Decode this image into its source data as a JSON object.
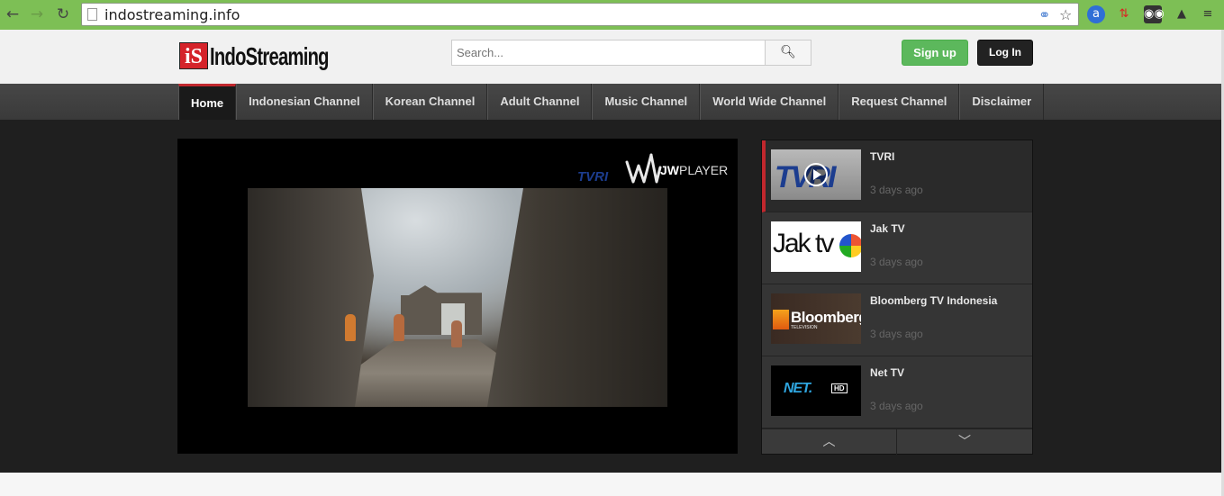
{
  "browser": {
    "url": "indostreaming.info",
    "back_icon": "back-arrow-icon",
    "forward_icon": "forward-arrow-icon",
    "reload_icon": "reload-icon",
    "translate_icon": "translate-icon",
    "bookmark_icon": "star-icon",
    "extensions": [
      "extension-a-icon",
      "extension-arrows-icon",
      "extension-glasses-icon",
      "extension-tower-icon",
      "menu-icon"
    ]
  },
  "header": {
    "logo_mark": "iS",
    "logo_text": "IndoStreaming",
    "search": {
      "placeholder": "Search...",
      "icon": "search-icon"
    },
    "signup_label": "Sign up",
    "login_label": "Log In"
  },
  "menu": {
    "items": [
      {
        "label": "Home",
        "active": true
      },
      {
        "label": "Indonesian Channel"
      },
      {
        "label": "Korean Channel"
      },
      {
        "label": "Adult Channel"
      },
      {
        "label": "Music Channel"
      },
      {
        "label": "World Wide Channel"
      },
      {
        "label": "Request Channel"
      },
      {
        "label": "Disclaimer"
      }
    ]
  },
  "player": {
    "watermark": "TVRI",
    "brand_prefix": "JW",
    "brand_suffix": "PLAYER"
  },
  "channels": {
    "items": [
      {
        "name": "TVRI",
        "time": "3 days ago",
        "active": true,
        "thumb_text": "TVRI"
      },
      {
        "name": "Jak TV",
        "time": "3 days ago",
        "thumb_text": "Jak tv"
      },
      {
        "name": "Bloomberg TV Indonesia",
        "time": "3 days ago",
        "thumb_text": "Bloomberg",
        "thumb_sub": "TELEVISION"
      },
      {
        "name": "Net TV",
        "time": "3 days ago",
        "thumb_text": "NET.",
        "thumb_sub": "HD"
      }
    ],
    "prev_icon": "chevron-up-icon",
    "next_icon": "chevron-down-icon"
  },
  "colors": {
    "accent": "#c1272d",
    "signup": "#5cb85c",
    "chrome_bar": "#7dbf55"
  }
}
